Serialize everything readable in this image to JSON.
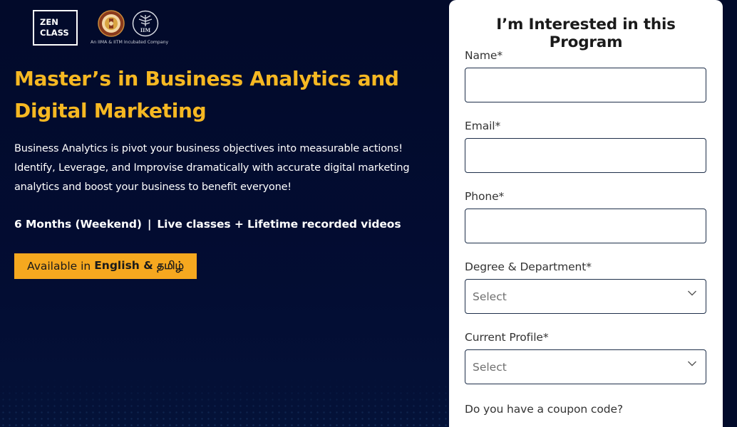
{
  "brand": {
    "zen_line1": "ZEN",
    "zen_line2": "CLASS",
    "partners_caption": "An IIMA & IITM Incubated Company",
    "iim_text": "IIM"
  },
  "hero": {
    "title": "Master’s in Business Analytics and Digital Marketing",
    "description": "Business Analytics is pivot your business objectives into measurable actions! Identify, Leverage, and Improvise dramatically with accurate digital marketing analytics and boost your business to benefit everyone!",
    "duration": "6 Months (Weekend)",
    "separator": "|",
    "mode": "Live classes + Lifetime recorded videos",
    "language_prefix": "Available in",
    "languages": "English & தமிழ்"
  },
  "form": {
    "title": "I’m Interested in this Program",
    "name_label": "Name*",
    "name_value": "",
    "email_label": "Email*",
    "email_value": "",
    "phone_label": "Phone*",
    "phone_value": "",
    "degree_label": "Degree & Department*",
    "degree_selected": "Select",
    "profile_label": "Current Profile*",
    "profile_selected": "Select",
    "coupon_question": "Do you have a coupon code?"
  },
  "colors": {
    "background": "#020b2b",
    "accent_yellow": "#f6b822",
    "badge_orange": "#f6a81f",
    "input_border": "#1e2f4a"
  }
}
